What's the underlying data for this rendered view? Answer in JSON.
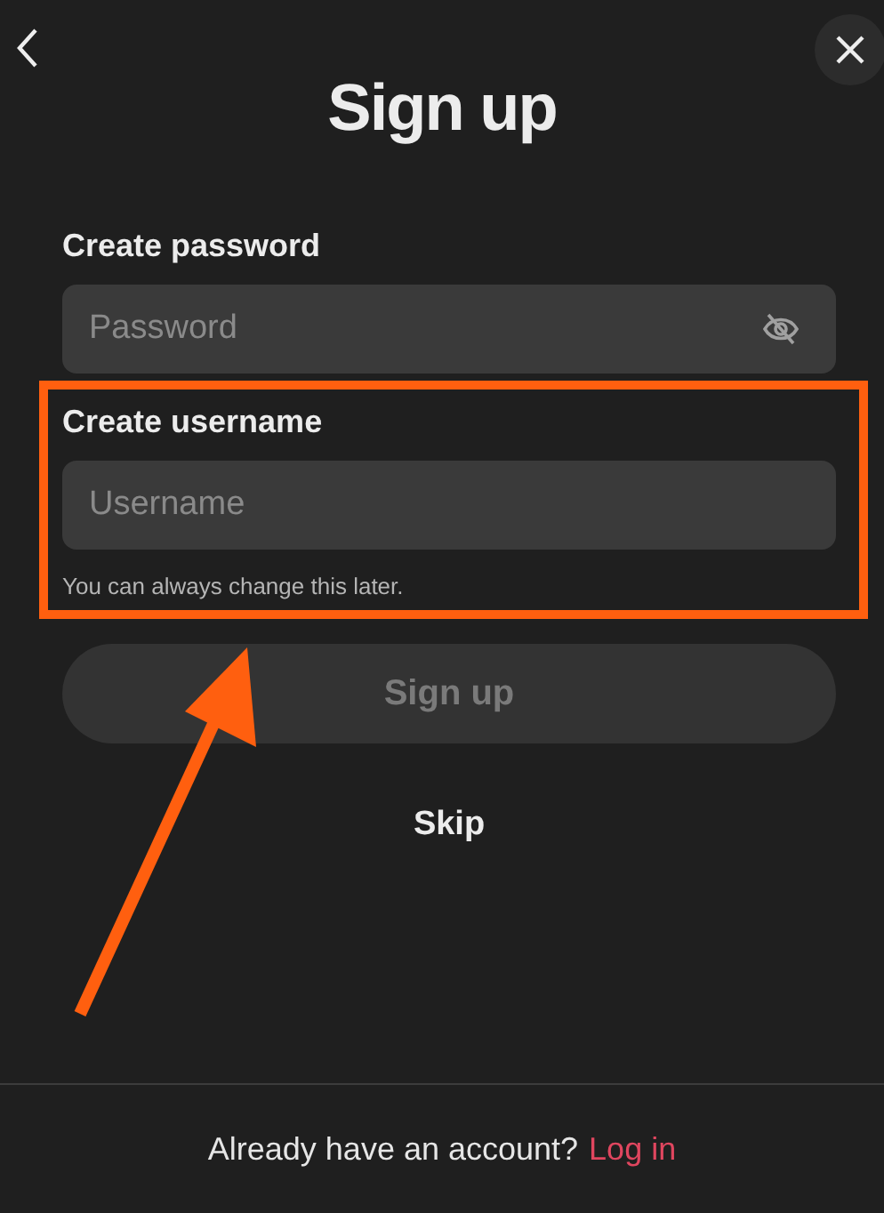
{
  "title": "Sign up",
  "password": {
    "label": "Create password",
    "placeholder": "Password"
  },
  "username": {
    "label": "Create username",
    "placeholder": "Username",
    "hint": "You can always change this later.",
    "highlighted": true
  },
  "signup_button": {
    "label": "Sign up",
    "disabled": true
  },
  "skip": "Skip",
  "footer": {
    "text": "Already have an account?",
    "link": "Log in"
  }
}
